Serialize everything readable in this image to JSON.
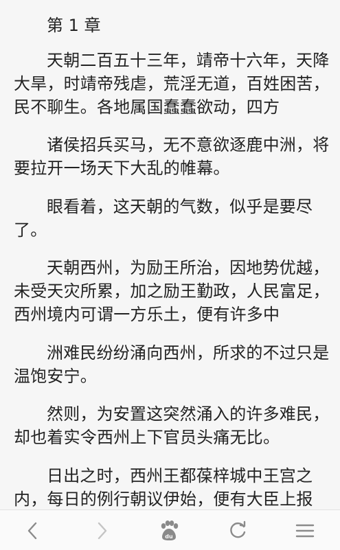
{
  "chapter": {
    "title": "第 1 章",
    "paragraphs": [
      "天朝二百五十三年，靖帝十六年，天降大旱，时靖帝残虐，荒淫无道，百姓困苦，民不聊生。各地属国蠢蠢欲动，四方",
      "诸侯招兵买马，无不意欲逐鹿中洲，将要拉开一场天下大乱的帷幕。",
      "眼看着，这天朝的气数，似乎是要尽了。",
      "天朝西州，为励王所治，因地势优越，未受天灾所累，加之励王勤政，人民富足，西州境内可谓一方乐土，便有许多中",
      "洲难民纷纷涌向西州，所求的不过只是温饱安宁。",
      "然则，为安置这突然涌入的许多难民，却也着实令西州上下官员头痛无比。",
      "日出之时，西州王都葆梓城中王宫之内，每日的例行朝议伊始，便有大臣上报"
    ]
  },
  "navbar": {
    "back_icon": "chevron-left-icon",
    "forward_icon": "chevron-right-icon",
    "home_icon": "baidu-paw-icon",
    "refresh_icon": "refresh-icon",
    "menu_icon": "hamburger-menu-icon"
  },
  "colors": {
    "background": "#f6f6f6",
    "text": "#222222",
    "icon": "#8a8a8a"
  }
}
